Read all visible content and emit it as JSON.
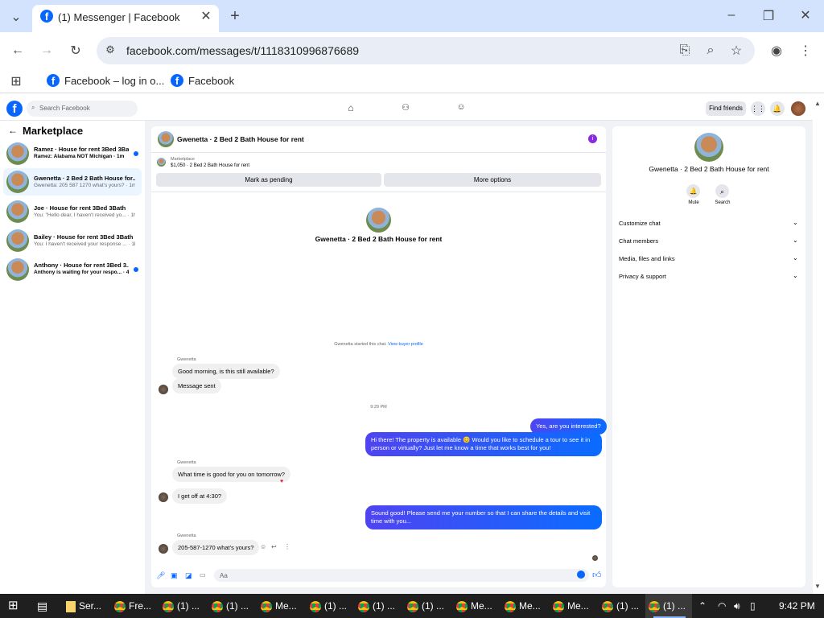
{
  "browser": {
    "tab_title": "(1) Messenger | Facebook",
    "url": "facebook.com/messages/t/1118310996876689",
    "bookmarks": [
      "Facebook – log in o...",
      "Facebook"
    ]
  },
  "header": {
    "search_placeholder": "Search Facebook",
    "find_friends": "Find friends"
  },
  "sidebar": {
    "title": "Marketplace",
    "items": [
      {
        "title": "Ramez · House for rent 3Bed 3Ba...",
        "sub": "Ramez: Alabama NOT Michigan · 1m",
        "unread": true
      },
      {
        "title": "Gwenetta · 2 Bed 2 Bath House for...",
        "sub": "Gwenetta: 205 587 1270 what's yours? · 1m",
        "unread": false
      },
      {
        "title": "Joe · House for rent 3Bed 3Bath",
        "sub": "You: \"Hello dear, I haven't received yo... · 1h",
        "unread": false
      },
      {
        "title": "Bailey · House for rent 3Bed 3Bath",
        "sub": "You: I haven't received your response ... · 1h",
        "unread": false
      },
      {
        "title": "Anthony · House for rent 3Bed 3...",
        "sub": "Anthony is waiting for your respo... · 4h",
        "unread": true
      }
    ]
  },
  "chat": {
    "header_title": "Gwenetta · 2 Bed 2 Bath House for rent",
    "listing_label": "Marketplace",
    "listing_detail": "$1,050 · 2 Bed 2 Bath House for rent",
    "mark_pending": "Mark as pending",
    "more_options": "More options",
    "intro_title": "Gwenetta · 2 Bed 2 Bath House for rent",
    "started_text": "Gwenetta started this chat.",
    "view_profile": "View buyer profile",
    "sender_name": "Gwenetta",
    "msg1": "Good morning, is this still available?",
    "msg2": "Message sent",
    "time1": "9:29 PM",
    "msg3": "Yes, are you interested?",
    "msg4": "Hi there! The property is available 😊 Would you like to schedule a tour to see it in person or virtually? Just let me know a time that works best for you!",
    "msg5": "What time is good for you on tomorrow?",
    "msg6": "I get off at 4:30?",
    "msg7": "Sound good! Please send me your number so that I can share the details and visit time with you...",
    "msg8": "205-587-1270 what's yours?",
    "input_placeholder": "Aa"
  },
  "right": {
    "title": "Gwenetta · 2 Bed 2 Bath House for rent",
    "mute": "Mute",
    "search": "Search",
    "sections": [
      "Customize chat",
      "Chat members",
      "Media, files and links",
      "Privacy & support"
    ]
  },
  "taskbar": {
    "items": [
      "Ser...",
      "Fre...",
      "(1) ...",
      "(1) ...",
      "Me...",
      "(1) ...",
      "(1) ...",
      "(1) ...",
      "Me...",
      "Me...",
      "Me...",
      "(1) ...",
      "(1) ..."
    ],
    "time": "9:42 PM"
  },
  "colors": {
    "fb_blue": "#0866ff",
    "bubble_out": "#0a6cff"
  }
}
